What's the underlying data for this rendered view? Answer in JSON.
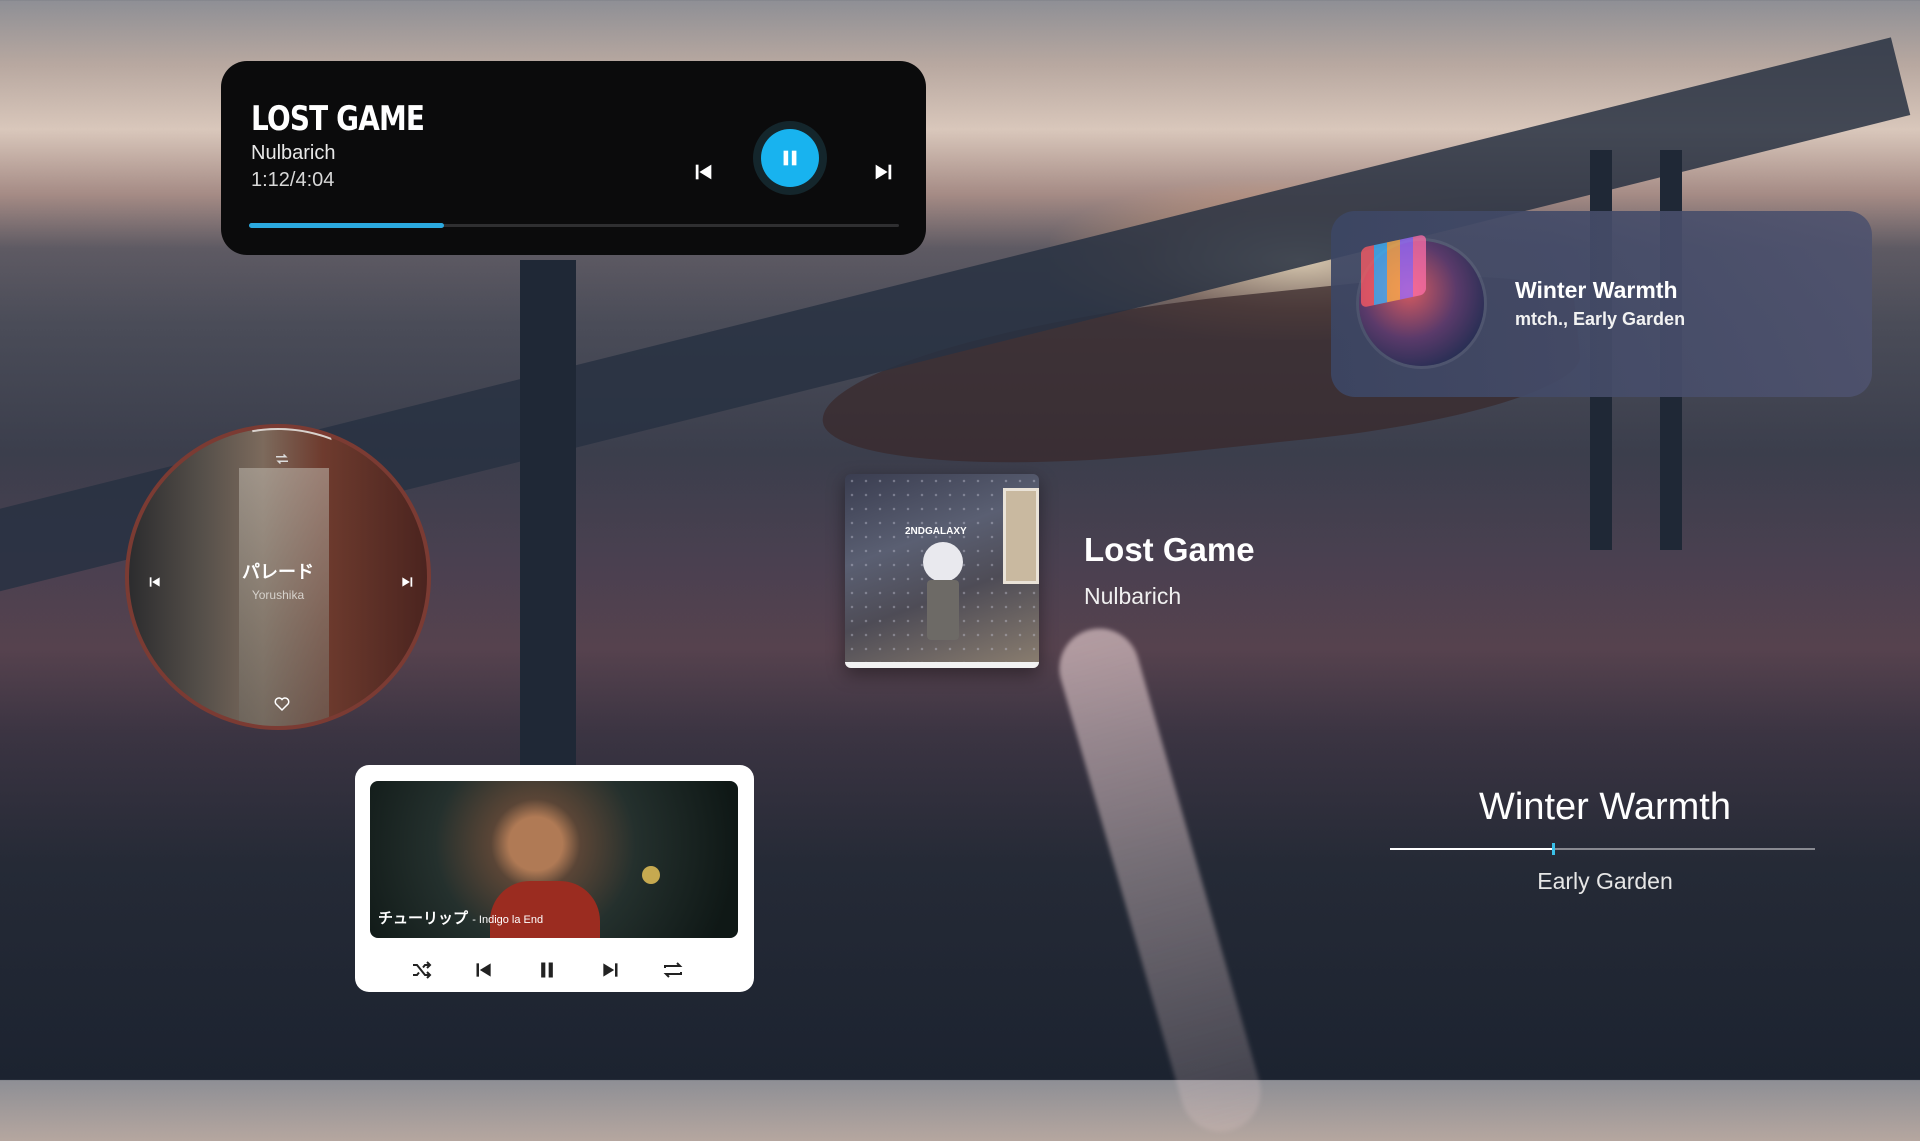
{
  "top_player": {
    "title": "LOST GAME",
    "artist": "Nulbarich",
    "time": "1:12/4:04",
    "progress_fraction": 0.3,
    "accent": "#18b3ef"
  },
  "glass_player": {
    "title": "Winter Warmth",
    "subtitle": "mtch., Early Garden"
  },
  "round_player": {
    "title": "パレード",
    "artist": "Yorushika",
    "ring_color": "#7b3b33"
  },
  "center_card": {
    "title": "Lost Game",
    "artist": "Nulbarich",
    "art_label": "2NDGALAXY"
  },
  "white_player": {
    "title": "チューリップ",
    "artist": "- Indigo la End"
  },
  "text_player": {
    "title": "Winter Warmth",
    "artist": "Early Garden",
    "progress_fraction": 0.38
  },
  "icons": [
    "skip-previous-icon",
    "pause-icon",
    "skip-next-icon",
    "repeat-icon",
    "heart-icon",
    "shuffle-icon"
  ]
}
